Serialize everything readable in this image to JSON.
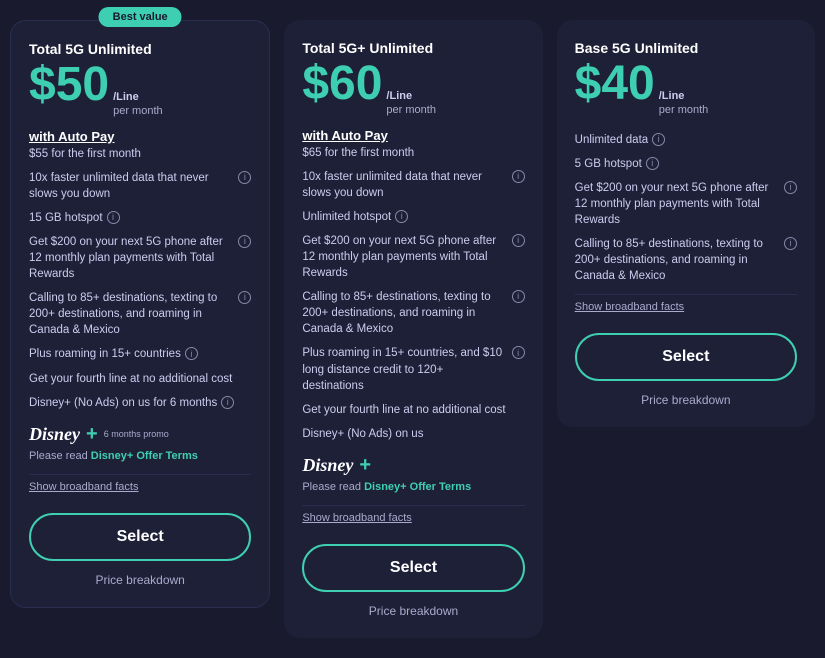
{
  "plans": [
    {
      "id": "total-5g-unlimited",
      "name": "Total 5G Unlimited",
      "badge": "Best value",
      "has_badge": true,
      "price": "$50",
      "price_suffix_line1": "/Line",
      "price_suffix_line2": "per month",
      "auto_pay_label": "with Auto Pay",
      "first_month": "$55 for the first month",
      "features": [
        "10x faster unlimited data that never slows you down",
        "15 GB hotspot",
        "Get $200 on your next 5G phone after 12 monthly plan payments with Total Rewards",
        "Calling to 85+ destinations, texting to 200+ destinations, and roaming in Canada & Mexico",
        "Plus roaming in 15+ countries",
        "Get your fourth line at no additional cost",
        "Disney+ (No Ads) on us for 6 months"
      ],
      "features_has_info": [
        true,
        true,
        true,
        true,
        true,
        false,
        true
      ],
      "has_disney": true,
      "disney_promo": "6 months promo",
      "offer_terms_text": "Please read ",
      "offer_terms_link": "Disney+ Offer Terms",
      "broadband": "Show broadband facts",
      "select_label": "Select",
      "price_breakdown_label": "Price breakdown"
    },
    {
      "id": "total-5g-plus-unlimited",
      "name": "Total 5G+ Unlimited",
      "badge": null,
      "has_badge": false,
      "price": "$60",
      "price_suffix_line1": "/Line",
      "price_suffix_line2": "per month",
      "auto_pay_label": "with Auto Pay",
      "first_month": "$65 for the first month",
      "features": [
        "10x faster unlimited data that never slows you down",
        "Unlimited hotspot",
        "Get $200 on your next 5G phone after 12 monthly plan payments with Total Rewards",
        "Calling to 85+ destinations, texting to 200+ destinations, and roaming in Canada & Mexico",
        "Plus roaming in 15+ countries, and $10 long distance credit to 120+ destinations",
        "Get your fourth line at no additional cost",
        "Disney+ (No Ads) on us"
      ],
      "features_has_info": [
        true,
        true,
        true,
        true,
        true,
        false,
        false
      ],
      "has_disney": true,
      "disney_promo": null,
      "offer_terms_text": "Please read ",
      "offer_terms_link": "Disney+ Offer Terms",
      "broadband": "Show broadband facts",
      "select_label": "Select",
      "price_breakdown_label": "Price breakdown"
    },
    {
      "id": "base-5g-unlimited",
      "name": "Base 5G Unlimited",
      "badge": null,
      "has_badge": false,
      "price": "$40",
      "price_suffix_line1": "/Line",
      "price_suffix_line2": "per month",
      "auto_pay_label": null,
      "first_month": null,
      "features": [
        "Unlimited data",
        "5 GB hotspot",
        "Get $200 on your next 5G phone after 12 monthly plan payments with Total Rewards",
        "Calling to 85+ destinations, texting to 200+ destinations, and roaming in Canada & Mexico"
      ],
      "features_has_info": [
        true,
        true,
        true,
        true
      ],
      "has_disney": false,
      "disney_promo": null,
      "offer_terms_text": null,
      "offer_terms_link": null,
      "broadband": "Show broadband facts",
      "select_label": "Select",
      "price_breakdown_label": "Price breakdown"
    }
  ],
  "info_icon_label": "i"
}
